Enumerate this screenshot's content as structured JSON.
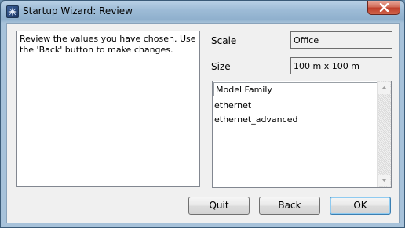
{
  "window": {
    "title": "Startup Wizard: Review"
  },
  "description": "Review the values you have chosen. Use the 'Back' button to make changes.",
  "fields": {
    "scale_label": "Scale",
    "scale_value": "Office",
    "size_label": "Size",
    "size_value": "100 m x 100 m"
  },
  "model_family": {
    "header": "Model Family",
    "items": [
      "ethernet",
      "ethernet_advanced"
    ]
  },
  "buttons": {
    "quit": "Quit",
    "back": "Back",
    "ok": "OK"
  },
  "icons": {
    "app": "star-compass-icon",
    "close": "close-icon",
    "scroll_up": "scroll-up-arrow-icon",
    "scroll_down": "scroll-down-arrow-icon"
  }
}
